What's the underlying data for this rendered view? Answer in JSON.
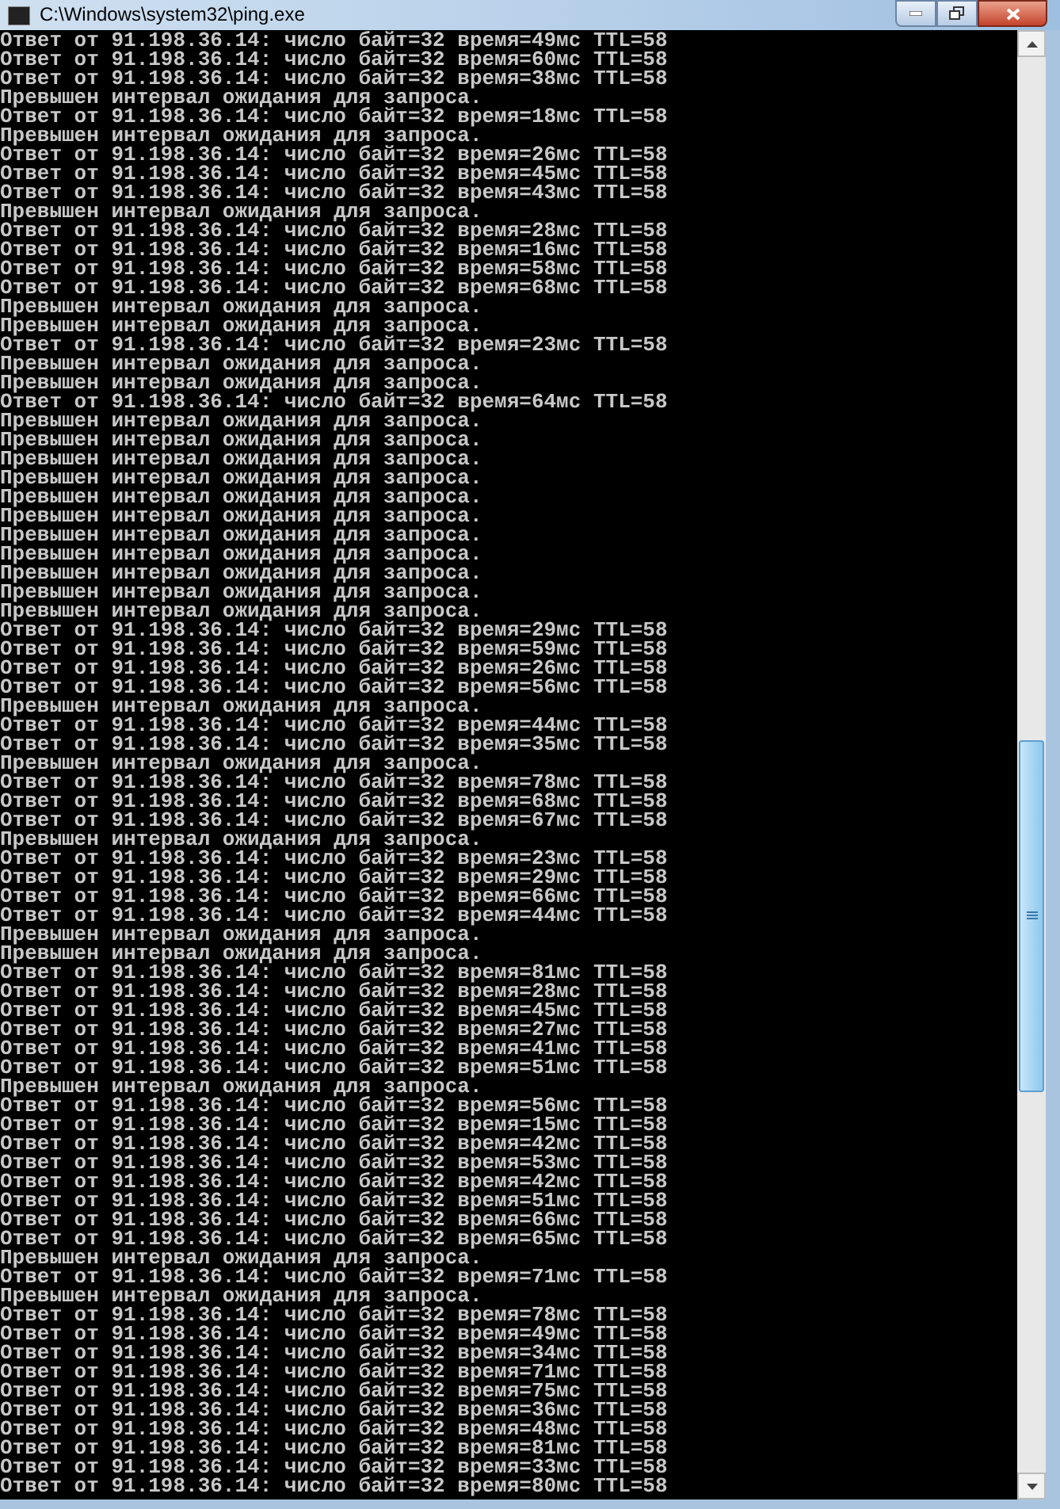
{
  "window": {
    "title": "C:\\Windows\\system32\\ping.exe"
  },
  "lines": [
    "Ответ от 91.198.36.14: число байт=32 время=49мс TTL=58",
    "Ответ от 91.198.36.14: число байт=32 время=60мс TTL=58",
    "Ответ от 91.198.36.14: число байт=32 время=38мс TTL=58",
    "Превышен интервал ожидания для запроса.",
    "Ответ от 91.198.36.14: число байт=32 время=18мс TTL=58",
    "Превышен интервал ожидания для запроса.",
    "Ответ от 91.198.36.14: число байт=32 время=26мс TTL=58",
    "Ответ от 91.198.36.14: число байт=32 время=45мс TTL=58",
    "Ответ от 91.198.36.14: число байт=32 время=43мс TTL=58",
    "Превышен интервал ожидания для запроса.",
    "Ответ от 91.198.36.14: число байт=32 время=28мс TTL=58",
    "Ответ от 91.198.36.14: число байт=32 время=16мс TTL=58",
    "Ответ от 91.198.36.14: число байт=32 время=58мс TTL=58",
    "Ответ от 91.198.36.14: число байт=32 время=68мс TTL=58",
    "Превышен интервал ожидания для запроса.",
    "Превышен интервал ожидания для запроса.",
    "Ответ от 91.198.36.14: число байт=32 время=23мс TTL=58",
    "Превышен интервал ожидания для запроса.",
    "Превышен интервал ожидания для запроса.",
    "Ответ от 91.198.36.14: число байт=32 время=64мс TTL=58",
    "Превышен интервал ожидания для запроса.",
    "Превышен интервал ожидания для запроса.",
    "Превышен интервал ожидания для запроса.",
    "Превышен интервал ожидания для запроса.",
    "Превышен интервал ожидания для запроса.",
    "Превышен интервал ожидания для запроса.",
    "Превышен интервал ожидания для запроса.",
    "Превышен интервал ожидания для запроса.",
    "Превышен интервал ожидания для запроса.",
    "Превышен интервал ожидания для запроса.",
    "Превышен интервал ожидания для запроса.",
    "Ответ от 91.198.36.14: число байт=32 время=29мс TTL=58",
    "Ответ от 91.198.36.14: число байт=32 время=59мс TTL=58",
    "Ответ от 91.198.36.14: число байт=32 время=26мс TTL=58",
    "Ответ от 91.198.36.14: число байт=32 время=56мс TTL=58",
    "Превышен интервал ожидания для запроса.",
    "Ответ от 91.198.36.14: число байт=32 время=44мс TTL=58",
    "Ответ от 91.198.36.14: число байт=32 время=35мс TTL=58",
    "Превышен интервал ожидания для запроса.",
    "Ответ от 91.198.36.14: число байт=32 время=78мс TTL=58",
    "Ответ от 91.198.36.14: число байт=32 время=68мс TTL=58",
    "Ответ от 91.198.36.14: число байт=32 время=67мс TTL=58",
    "Превышен интервал ожидания для запроса.",
    "Ответ от 91.198.36.14: число байт=32 время=23мс TTL=58",
    "Ответ от 91.198.36.14: число байт=32 время=29мс TTL=58",
    "Ответ от 91.198.36.14: число байт=32 время=66мс TTL=58",
    "Ответ от 91.198.36.14: число байт=32 время=44мс TTL=58",
    "Превышен интервал ожидания для запроса.",
    "Превышен интервал ожидания для запроса.",
    "Ответ от 91.198.36.14: число байт=32 время=81мс TTL=58",
    "Ответ от 91.198.36.14: число байт=32 время=28мс TTL=58",
    "Ответ от 91.198.36.14: число байт=32 время=45мс TTL=58",
    "Ответ от 91.198.36.14: число байт=32 время=27мс TTL=58",
    "Ответ от 91.198.36.14: число байт=32 время=41мс TTL=58",
    "Ответ от 91.198.36.14: число байт=32 время=51мс TTL=58",
    "Превышен интервал ожидания для запроса.",
    "Ответ от 91.198.36.14: число байт=32 время=56мс TTL=58",
    "Ответ от 91.198.36.14: число байт=32 время=15мс TTL=58",
    "Ответ от 91.198.36.14: число байт=32 время=42мс TTL=58",
    "Ответ от 91.198.36.14: число байт=32 время=53мс TTL=58",
    "Ответ от 91.198.36.14: число байт=32 время=42мс TTL=58",
    "Ответ от 91.198.36.14: число байт=32 время=51мс TTL=58",
    "Ответ от 91.198.36.14: число байт=32 время=66мс TTL=58",
    "Ответ от 91.198.36.14: число байт=32 время=65мс TTL=58",
    "Превышен интервал ожидания для запроса.",
    "Ответ от 91.198.36.14: число байт=32 время=71мс TTL=58",
    "Превышен интервал ожидания для запроса.",
    "Ответ от 91.198.36.14: число байт=32 время=78мс TTL=58",
    "Ответ от 91.198.36.14: число байт=32 время=49мс TTL=58",
    "Ответ от 91.198.36.14: число байт=32 время=34мс TTL=58",
    "Ответ от 91.198.36.14: число байт=32 время=71мс TTL=58",
    "Ответ от 91.198.36.14: число байт=32 время=75мс TTL=58",
    "Ответ от 91.198.36.14: число байт=32 время=36мс TTL=58",
    "Ответ от 91.198.36.14: число байт=32 время=48мс TTL=58",
    "Ответ от 91.198.36.14: число байт=32 время=81мс TTL=58",
    "Ответ от 91.198.36.14: число байт=32 время=33мс TTL=58",
    "Ответ от 91.198.36.14: число байт=32 время=80мс TTL=58"
  ]
}
